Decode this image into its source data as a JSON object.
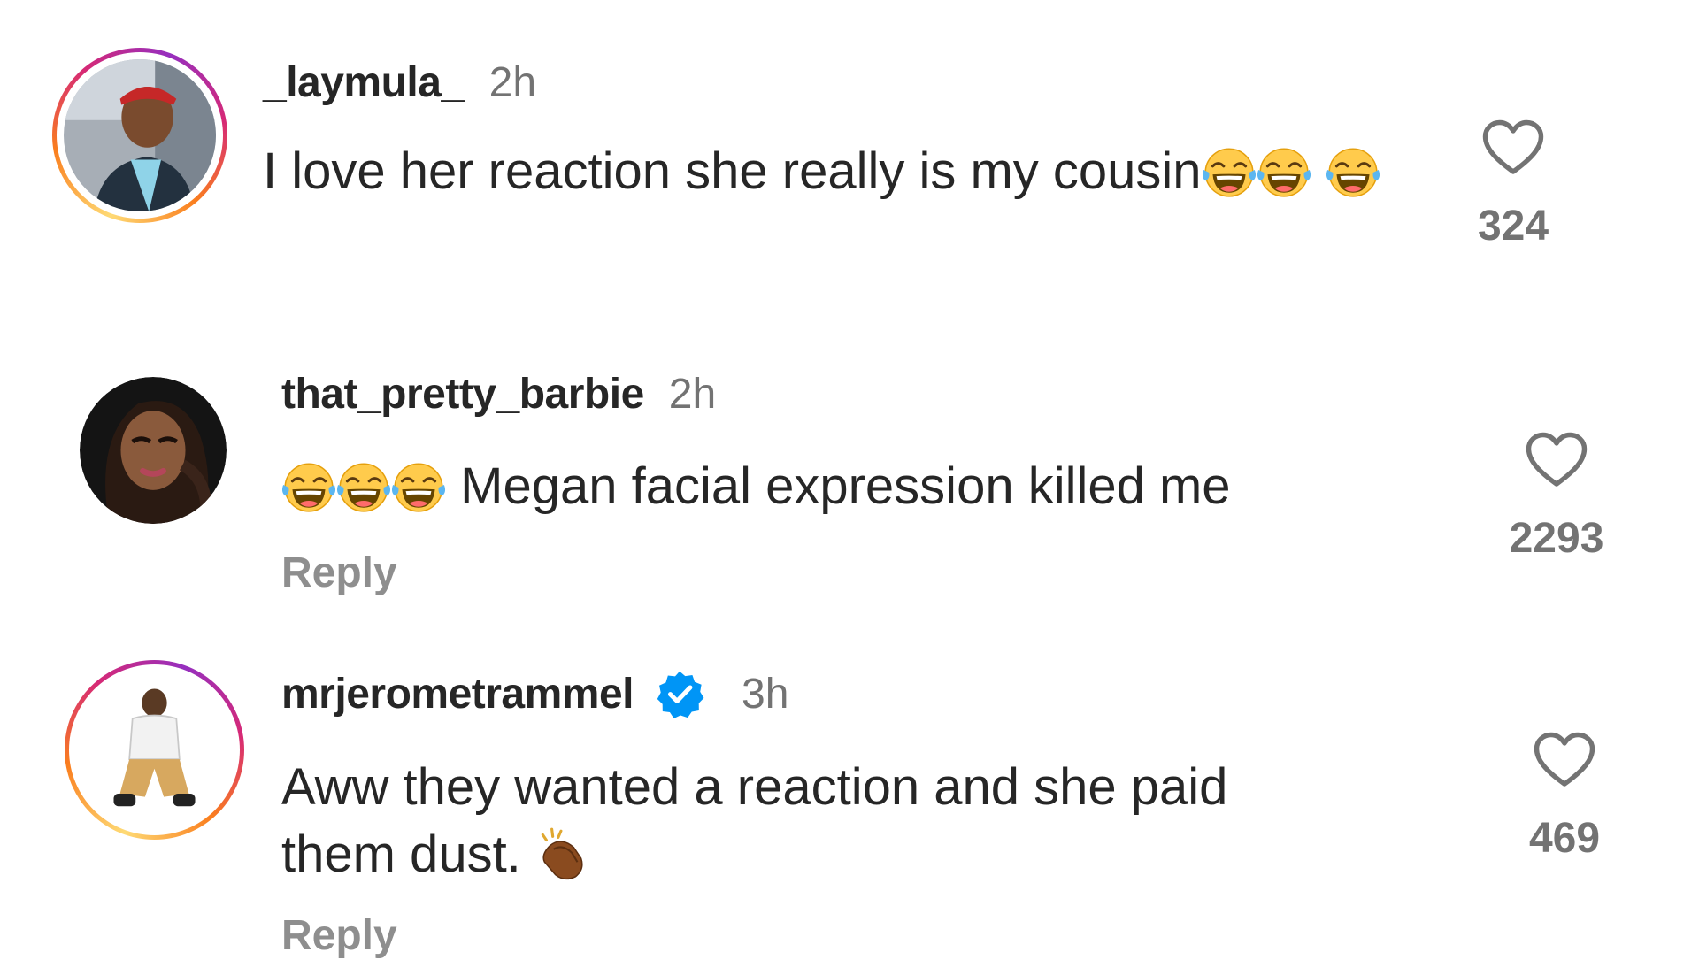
{
  "comments": [
    {
      "username": "_laymula_",
      "time": "2h",
      "text": "I love her reaction she really is my cousin",
      "like_count": "324"
    },
    {
      "username": "that_pretty_barbie",
      "time": "2h",
      "text": "Megan facial expression killed me",
      "reply_label": "Reply",
      "like_count": "2293"
    },
    {
      "username": "mrjerometrammel",
      "time": "3h",
      "text_line1": "Aww they wanted a reaction and she paid",
      "text_line2": "them dust.",
      "reply_label": "Reply",
      "like_count": "469"
    }
  ],
  "icons": {
    "like": "heart-outline-icon",
    "laugh": "face-with-tears-of-joy-emoji",
    "clap": "clapping-hands-emoji",
    "verified": "verified-badge-icon"
  },
  "colors": {
    "text": "#262626",
    "secondary": "#737373",
    "reply": "#8e8e8e",
    "verified": "#0095f6"
  }
}
